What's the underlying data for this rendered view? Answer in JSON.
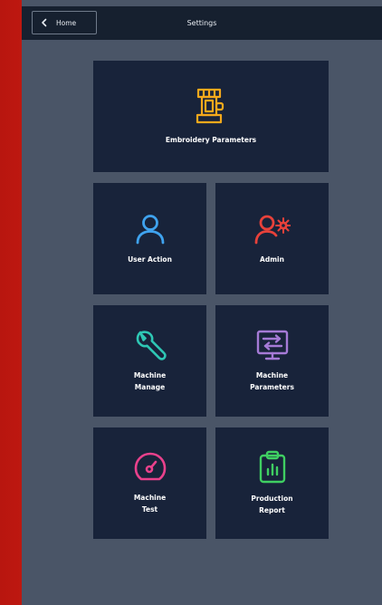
{
  "header": {
    "home_label": "Home",
    "title": "Settings"
  },
  "tiles": {
    "embroidery": {
      "label": "Embroidery Parameters",
      "icon": "sewing-machine-icon",
      "color": "#f5a91c"
    },
    "user_action": {
      "label": "User Action",
      "icon": "user-icon",
      "color": "#3fa3ef"
    },
    "admin": {
      "label": "Admin",
      "icon": "admin-gear-icon",
      "color": "#e8413a"
    },
    "machine_manage": {
      "label": "Machine\nManage",
      "icon": "wrench-icon",
      "color": "#2ec7b4"
    },
    "machine_parameters": {
      "label": "Machine\nParameters",
      "icon": "monitor-arrows-icon",
      "color": "#a57ad6"
    },
    "machine_test": {
      "label": "Machine\nTest",
      "icon": "gauge-icon",
      "color": "#e9418c"
    },
    "production_report": {
      "label": "Production\nReport",
      "icon": "clipboard-chart-icon",
      "color": "#3fcf62"
    }
  },
  "colors": {
    "background": "#4a5567",
    "topbar": "#16202f",
    "tile": "#18233a",
    "frame": "#d41f14"
  }
}
